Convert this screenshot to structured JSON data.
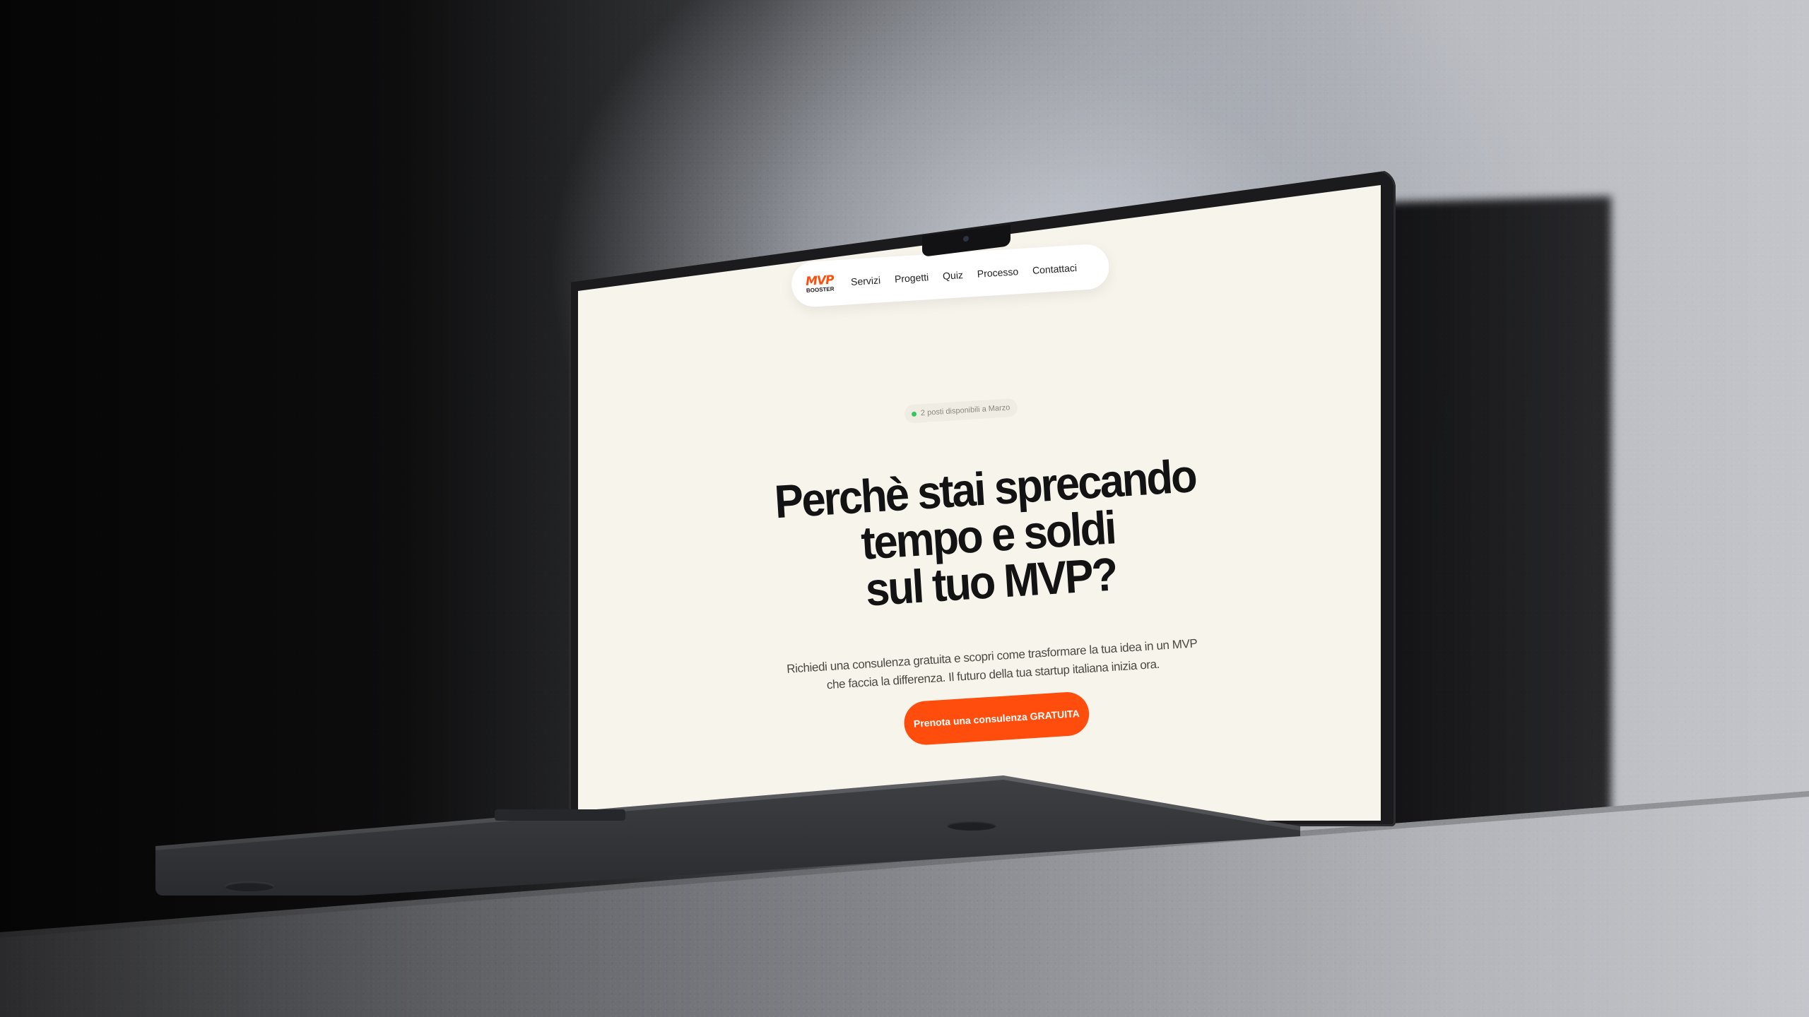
{
  "site": {
    "logo": {
      "mark": "MVP",
      "sub": "BOOSTER"
    },
    "nav": [
      {
        "label": "Servizi"
      },
      {
        "label": "Progetti"
      },
      {
        "label": "Quiz"
      },
      {
        "label": "Processo"
      },
      {
        "label": "Contattaci"
      }
    ],
    "badge": "2 posti disponibili a Marzo",
    "headline": [
      "Perchè stai sprecando",
      "tempo e soldi",
      "sul tuo MVP?"
    ],
    "subheadline": [
      "Richiedi una consulenza gratuita e scopri come trasformare la tua idea in un MVP",
      "che faccia la differenza. Il futuro della tua startup italiana inizia ora."
    ],
    "cta_label": "Prenota una consulenza GRATUITA"
  },
  "colors": {
    "accent": "#ff4d0d",
    "page_background": "#f7f4ec",
    "text": "#131313",
    "status_dot": "#34c759"
  }
}
